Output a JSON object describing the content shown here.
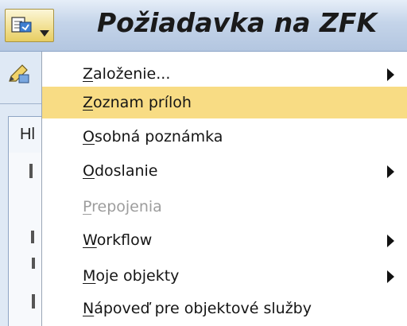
{
  "window": {
    "title": "Požiadavka na ZFK",
    "services_button_icon": "generic-object-services-icon",
    "dropdown_icon": "dropdown-arrow-icon"
  },
  "background_app": {
    "toolbar_icon": "edit-pencil-icon",
    "tab_label_partial": "Hl"
  },
  "menu": {
    "items": [
      {
        "accel": "Z",
        "rest": "aloženie...",
        "has_submenu": true,
        "highlighted": false,
        "disabled": false
      },
      {
        "accel": "Z",
        "rest": "oznam príloh",
        "has_submenu": false,
        "highlighted": true,
        "disabled": false
      },
      {
        "accel": "O",
        "rest": "sobná poznámka",
        "has_submenu": false,
        "highlighted": false,
        "disabled": false
      },
      {
        "accel": "O",
        "rest": "doslanie",
        "has_submenu": true,
        "highlighted": false,
        "disabled": false
      },
      {
        "accel": "P",
        "rest": "repojenia",
        "has_submenu": false,
        "highlighted": false,
        "disabled": true
      },
      {
        "accel": "W",
        "rest": "orkflow",
        "has_submenu": true,
        "highlighted": false,
        "disabled": false
      },
      {
        "accel": "M",
        "rest": "oje objekty",
        "has_submenu": true,
        "highlighted": false,
        "disabled": false
      },
      {
        "accel": "N",
        "rest": "ápoveď pre objektové služby",
        "has_submenu": false,
        "highlighted": false,
        "disabled": false
      }
    ]
  },
  "colors": {
    "highlight": "#f8dc84",
    "disabled_text": "#9d9d9d",
    "titlebar": "#c4d4e9"
  }
}
